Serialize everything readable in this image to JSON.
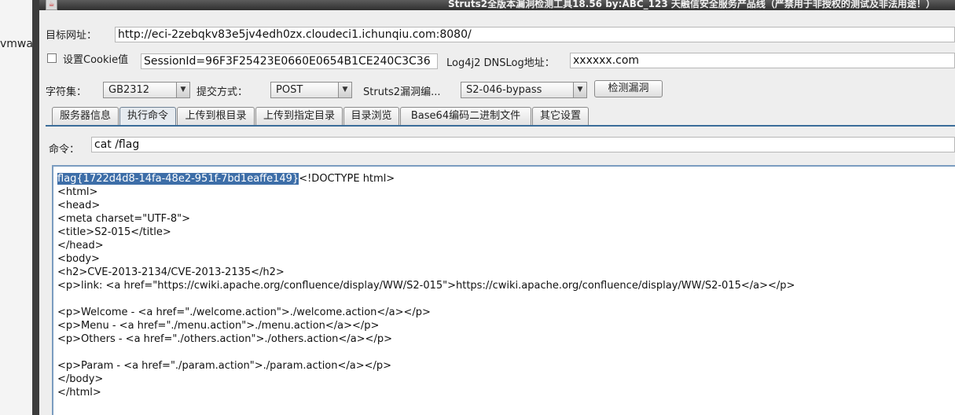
{
  "background": {
    "left_text": "vmwa"
  },
  "window": {
    "title": "Struts2全版本漏洞检测工具18.56 by:ABC_123 天融信安全服务产品线（严禁用于非授权的测试及非法用途！）"
  },
  "form": {
    "url_label": "目标网址：",
    "url_value": "http://eci-2zebqkv83e5jv4edh0zx.cloudeci1.ichunqiu.com:8080/",
    "cookie_label": "设置Cookie值",
    "cookie_checked": false,
    "cookie_value": "SessionId=96F3F25423E0660E0654B1CE240C3C36",
    "dnslog_label": "Log4j2 DNSLog地址：",
    "dnslog_value": "xxxxxx.com",
    "charset_label": "字符集：",
    "charset_value": "GB2312",
    "method_label": "提交方式：",
    "method_value": "POST",
    "vuln_label": "Struts2漏洞编...",
    "vuln_value": "S2-046-bypass",
    "detect_button": "检测漏洞"
  },
  "tabs": [
    {
      "label": "服务器信息",
      "active": false
    },
    {
      "label": "执行命令",
      "active": true
    },
    {
      "label": "上传到根目录",
      "active": false
    },
    {
      "label": "上传到指定目录",
      "active": false
    },
    {
      "label": "目录浏览",
      "active": false
    },
    {
      "label": "Base64编码二进制文件",
      "active": false
    },
    {
      "label": "其它设置",
      "active": false
    }
  ],
  "command": {
    "label": "命令：",
    "value": "cat /flag"
  },
  "output": {
    "selected": "flag{1722d4d8-14fa-48e2-951f-7bd1eaffe149}",
    "lines": [
      "<!DOCTYPE html>",
      "<html>",
      "<head>",
      "<meta charset=\"UTF-8\">",
      "<title>S2-015</title>",
      "</head>",
      "<body>",
      "<h2>CVE-2013-2134/CVE-2013-2135</h2>",
      "<p>link: <a href=\"https://cwiki.apache.org/confluence/display/WW/S2-015\">https://cwiki.apache.org/confluence/display/WW/S2-015</a></p>",
      "",
      "<p>Welcome - <a href=\"./welcome.action\">./welcome.action</a></p>",
      "<p>Menu - <a href=\"./menu.action\">./menu.action</a></p>",
      "<p>Others - <a href=\"./others.action\">./others.action</a></p>",
      "",
      "<p>Param - <a href=\"./param.action\">./param.action</a></p>",
      "</body>",
      "</html>"
    ]
  },
  "icons": {
    "app": "java-cup-icon",
    "dropdown": "triangle-down-icon"
  }
}
